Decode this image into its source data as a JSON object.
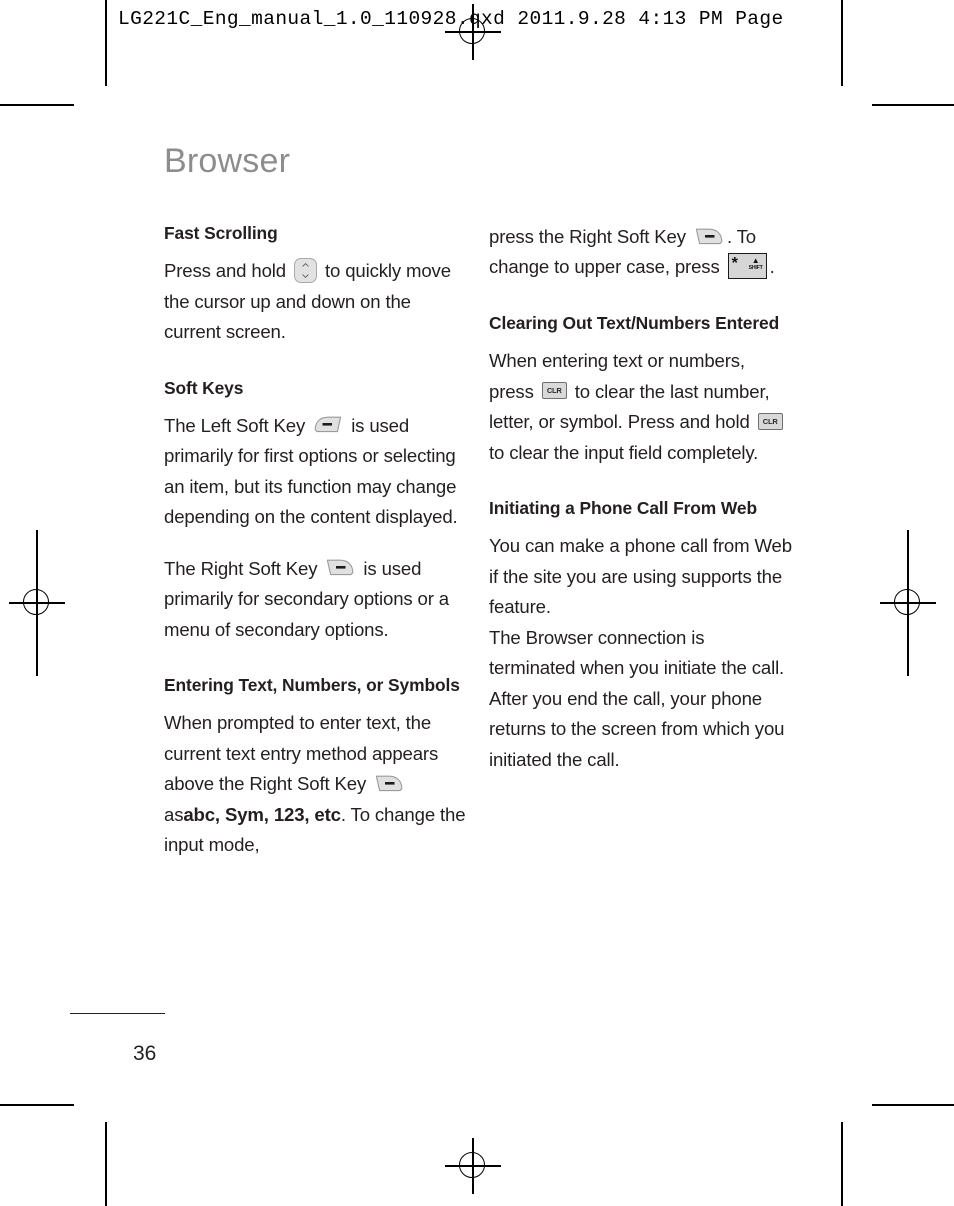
{
  "file_header": "LG221C_Eng_manual_1.0_110928.qxd   2011.9.28   4:13 PM   Page",
  "page_title": "Browser",
  "page_number": "36",
  "icons": {
    "nav_key": "nav-key-icon",
    "left_soft_key": "left-soft-key-icon",
    "right_soft_key": "right-soft-key-icon",
    "clr_key": "clr-key-icon",
    "shift_key": "star-shift-key-icon",
    "clr_label": "CLR",
    "shift_label": "SHIFT",
    "shift_glyph": "*"
  },
  "left_column": {
    "section_1": {
      "heading": "Fast Scrolling",
      "para_part_1": "Press and hold",
      "para_part_2": "to quickly move the cursor up and down on the current screen."
    },
    "section_2": {
      "heading": "Soft Keys",
      "para_1_part_1": "The Left Soft Key",
      "para_1_part_2": "is used primarily for first options or selecting an item, but its function may change depending on the content displayed.",
      "para_2_part_1": "The Right Soft Key",
      "para_2_part_2": "is used primarily for secondary options or a menu of secondary options."
    },
    "section_3": {
      "heading": "Entering Text, Numbers, or Symbols",
      "para_part_1": "When prompted to enter text, the current text entry method appears above the Right Soft Key",
      "para_part_2": "as",
      "para_bold_1": "abc, Sym, 123, etc",
      "para_part_3": ". To change the input mode,"
    }
  },
  "right_column": {
    "continued": {
      "part_1": "press the Right Soft Key",
      "part_2": ". To change to upper case, press",
      "part_3": "."
    },
    "section_1": {
      "heading": "Clearing Out Text/Numbers Entered",
      "para_part_1": "When entering text or numbers, press",
      "para_part_2": "to clear the last number, letter, or symbol. Press and hold",
      "para_part_3": "to clear the input field completely."
    },
    "section_2": {
      "heading": "Initiating a Phone Call From Web",
      "para_1": "You can make a phone call from Web if the site you are using supports the feature.",
      "para_2": "The Browser connection is terminated when you initiate the call. After you end the call, your phone returns to the screen from which you initiated the call."
    }
  }
}
